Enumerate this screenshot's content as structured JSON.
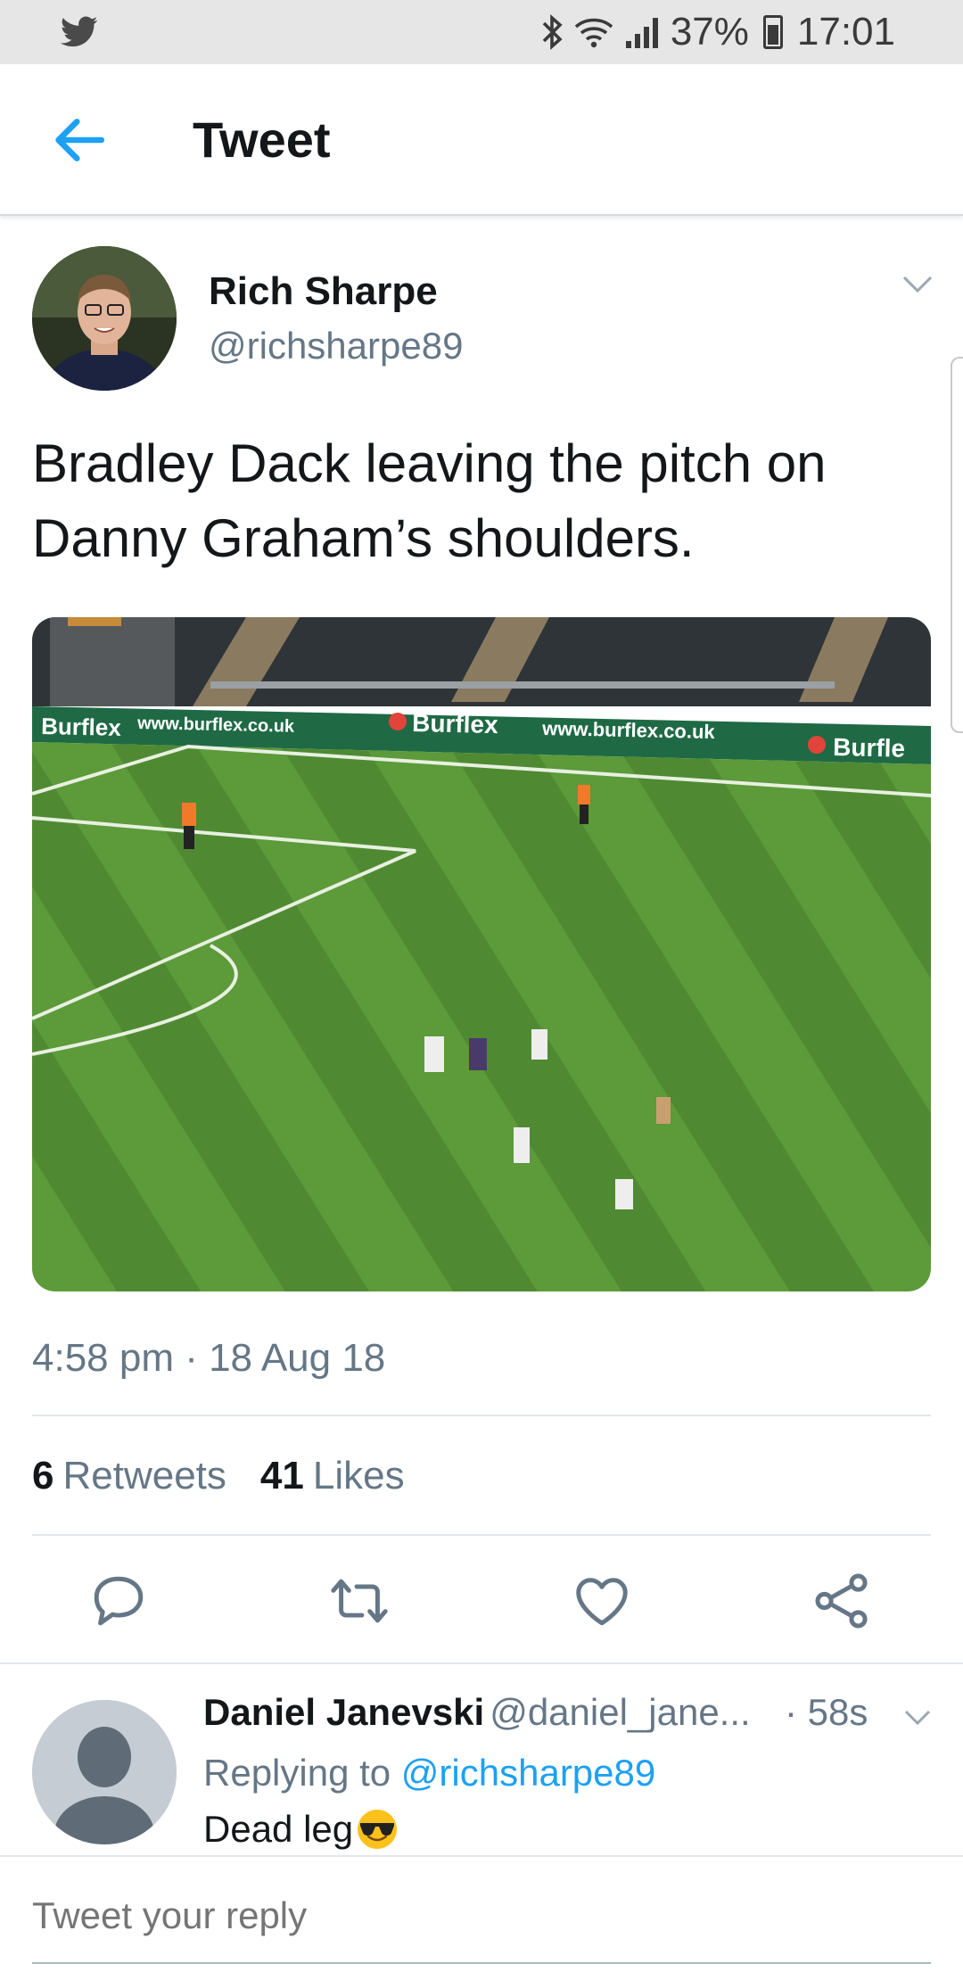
{
  "status_bar": {
    "battery": "37%",
    "time": "17:01",
    "icons": [
      "twitter-bird-icon",
      "bluetooth-icon",
      "wifi-icon",
      "signal-icon",
      "battery-icon"
    ]
  },
  "header": {
    "title": "Tweet",
    "back_icon": "arrow-left-icon"
  },
  "tweet": {
    "author_name": "Rich Sharpe",
    "author_handle": "@richsharpe89",
    "text": "Bradley Dack leaving the pitch on Danny Graham’s shoulders.",
    "timestamp": "4:58 pm · 18 Aug 18",
    "retweets_count": "6",
    "retweets_label": "Retweets",
    "likes_count": "41",
    "likes_label": "Likes",
    "media_banner_brand": "Burflex",
    "media_banner_url": "www.burflex.co.uk",
    "actions": [
      "reply-icon",
      "retweet-icon",
      "like-icon",
      "share-icon"
    ]
  },
  "reply": {
    "name": "Daniel Janevski",
    "handle": "@daniel_jane...",
    "time": "· 58s",
    "replying_prefix": "Replying to",
    "replying_to": "@richsharpe89",
    "text": "Dead leg"
  },
  "compose": {
    "placeholder": "Tweet your reply"
  },
  "colors": {
    "accent": "#1da1f2",
    "secondary_text": "#657786",
    "primary_text": "#14171a",
    "status_bar_bg": "#e6e6e6"
  }
}
